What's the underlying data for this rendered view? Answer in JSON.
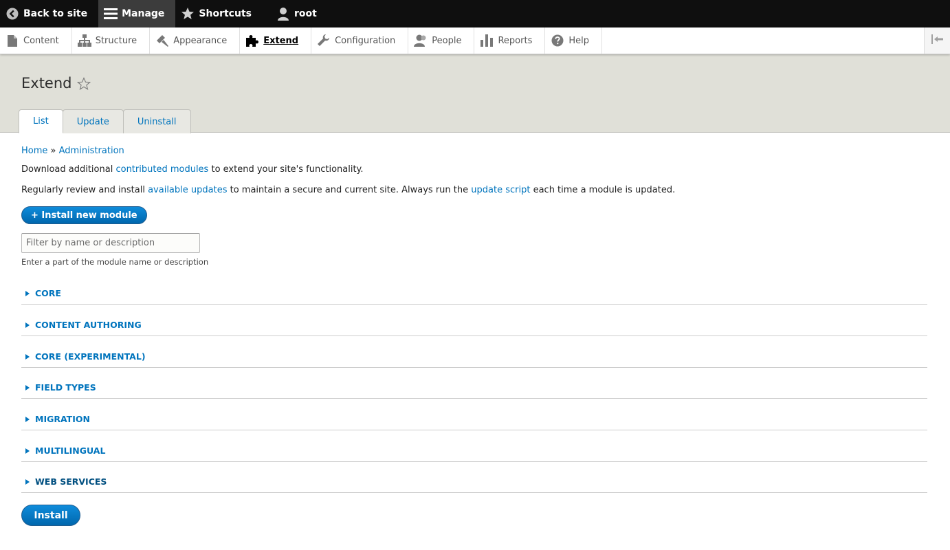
{
  "toolbar": {
    "back_label": "Back to site",
    "manage_label": "Manage",
    "shortcuts_label": "Shortcuts",
    "user_label": "root"
  },
  "tray": {
    "items": [
      {
        "label": "Content",
        "icon": "file-icon"
      },
      {
        "label": "Structure",
        "icon": "sitemap-icon"
      },
      {
        "label": "Appearance",
        "icon": "paintbrush-icon"
      },
      {
        "label": "Extend",
        "icon": "puzzle-icon"
      },
      {
        "label": "Configuration",
        "icon": "wrench-icon"
      },
      {
        "label": "People",
        "icon": "people-icon"
      },
      {
        "label": "Reports",
        "icon": "bar-chart-icon"
      },
      {
        "label": "Help",
        "icon": "help-icon"
      }
    ],
    "active": "Extend"
  },
  "header": {
    "title": "Extend",
    "tabs": [
      {
        "label": "List"
      },
      {
        "label": "Update"
      },
      {
        "label": "Uninstall"
      }
    ]
  },
  "breadcrumb": {
    "home": "Home",
    "separator": "»",
    "admin": "Administration"
  },
  "intro": {
    "p1_a": "Download additional",
    "p1_link": "contributed modules",
    "p1_b": "to extend your site's functionality.",
    "p2_a": "Regularly review and install",
    "p2_link1": "available updates",
    "p2_b": "to maintain a secure and current site. Always run the",
    "p2_link2": "update script",
    "p2_c": "each time a module is updated."
  },
  "install_new_label": "+ Install new module",
  "filter": {
    "placeholder": "Filter by name or description",
    "help": "Enter a part of the module name or description"
  },
  "packages": [
    {
      "label": "CORE"
    },
    {
      "label": "CONTENT AUTHORING"
    },
    {
      "label": "CORE (EXPERIMENTAL)"
    },
    {
      "label": "FIELD TYPES"
    },
    {
      "label": "MIGRATION"
    },
    {
      "label": "MULTILINGUAL"
    },
    {
      "label": "WEB SERVICES"
    }
  ],
  "install_label": "Install",
  "colors": {
    "link": "#0074bd",
    "toolbar_bg": "#0f0f0f",
    "header_bg": "#e0e0d8",
    "button_blue": "#0074bd"
  }
}
